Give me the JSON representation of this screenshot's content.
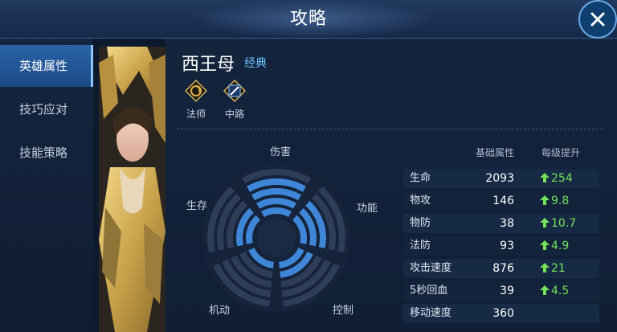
{
  "header": {
    "title": "攻略"
  },
  "sidebar": {
    "items": [
      {
        "label": "英雄属性",
        "active": true
      },
      {
        "label": "技巧应对",
        "active": false
      },
      {
        "label": "技能策略",
        "active": false
      }
    ]
  },
  "hero": {
    "name": "西王母",
    "tag": "经典",
    "roles": [
      {
        "label": "法师",
        "icon": "mage-icon"
      },
      {
        "label": "中路",
        "icon": "mid-lane-icon"
      }
    ]
  },
  "radar": {
    "labels": {
      "damage": "伤害",
      "ability": "功能",
      "control": "控制",
      "mobility": "机动",
      "survival": "生存"
    },
    "levels": {
      "damage": 4,
      "ability": 3,
      "control": 2,
      "mobility": 1,
      "survival": 2
    },
    "max_level": 5
  },
  "stats": {
    "header_base": "基础属性",
    "header_growth": "每级提升",
    "rows": [
      {
        "name": "生命",
        "value": "2093",
        "growth": "254"
      },
      {
        "name": "物攻",
        "value": "146",
        "growth": "9.8"
      },
      {
        "name": "物防",
        "value": "38",
        "growth": "10.7"
      },
      {
        "name": "法防",
        "value": "93",
        "growth": "4.9"
      },
      {
        "name": "攻击速度",
        "value": "876",
        "growth": "21"
      },
      {
        "name": "5秒回血",
        "value": "39",
        "growth": "4.5"
      },
      {
        "name": "移动速度",
        "value": "360",
        "growth": ""
      }
    ]
  },
  "colors": {
    "accent": "#2a63a8",
    "growth": "#74e35a",
    "radar_fill": "#3f86d9",
    "radar_empty": "#2e3e58"
  }
}
